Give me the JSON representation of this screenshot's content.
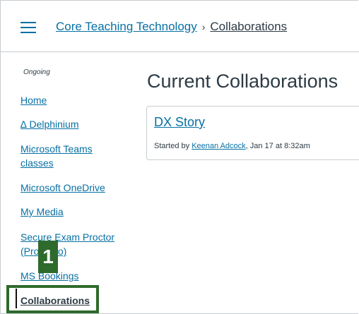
{
  "header": {
    "breadcrumb_course": "Core Teaching Technology",
    "breadcrumb_separator": "›",
    "breadcrumb_current": "Collaborations"
  },
  "nav": {
    "subtitle": "Ongoing",
    "items": [
      {
        "label": "Home"
      },
      {
        "label": "∆ Delphinium"
      },
      {
        "label": "Microsoft Teams classes"
      },
      {
        "label": "Microsoft OneDrive"
      },
      {
        "label": "My Media"
      },
      {
        "label": "Secure Exam Proctor (Proctorio)"
      },
      {
        "label": "MS Bookings"
      },
      {
        "label": "Collaborations"
      }
    ]
  },
  "annotation": {
    "step_number": "1",
    "highlight_color": "#2e6a2b"
  },
  "main": {
    "title": "Current Collaborations",
    "collaborations": [
      {
        "title": "DX Story",
        "started_by_prefix": "Started by ",
        "author": "Keenan Adcock",
        "date_text": ", Jan 17 at 8:32am"
      }
    ]
  },
  "colors": {
    "link": "#0770a3",
    "text": "#2d3b45",
    "border": "#c7cdd1"
  }
}
